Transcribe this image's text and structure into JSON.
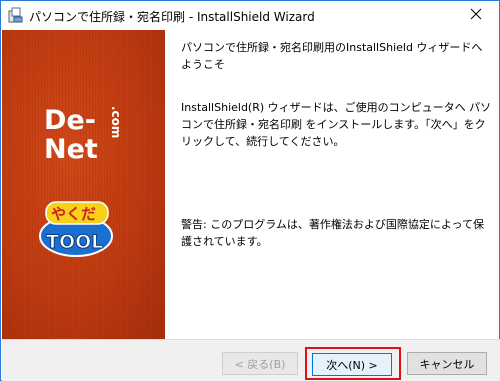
{
  "window": {
    "title": "パソコンで住所録・宛名印刷 - InstallShield Wizard"
  },
  "side_panel": {
    "logo_text": "De-Net.com",
    "logo2_text": "やくだTOOL"
  },
  "main": {
    "welcome": "パソコンで住所録・宛名印刷用のInstallShield ウィザードへようこそ",
    "description": "InstallShield(R) ウィザードは、ご使用のコンピュータへ パソコンで住所録・宛名印刷 をインストールします。「次へ」をクリックして、続行してください。",
    "warning": "警告: このプログラムは、著作権法および国際協定によって保護されています。"
  },
  "footer": {
    "back_label": "< 戻る(B)",
    "next_label": "次へ(N) >",
    "cancel_label": "キャンセル"
  },
  "colors": {
    "panel": "#bf3a10",
    "highlight": "#e0101a",
    "accent": "#0078d7"
  }
}
